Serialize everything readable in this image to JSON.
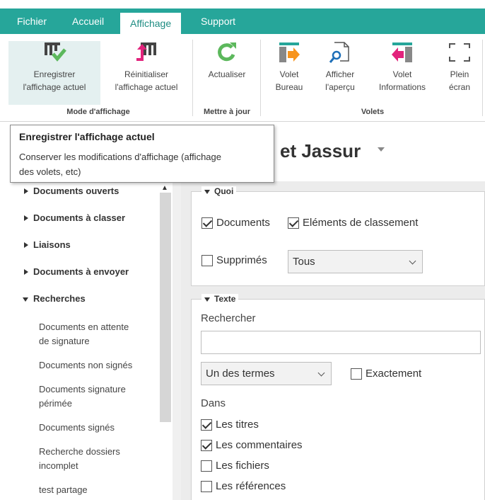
{
  "tabs": [
    "Fichier",
    "Accueil",
    "Affichage",
    "Support"
  ],
  "ribbon": {
    "enregistrer_l1": "Enregistrer",
    "enregistrer_l2": "l'affichage actuel",
    "reinitialiser_l1": "Réinitialiser",
    "reinitialiser_l2": "l'affichage actuel",
    "group_mode": "Mode d'affichage",
    "actualiser": "Actualiser",
    "group_maj": "Mettre à jour",
    "volet_bureau_l1": "Volet",
    "volet_bureau_l2": "Bureau",
    "apercu_l1": "Afficher",
    "apercu_l2": "l'aperçu",
    "volet_info_l1": "Volet",
    "volet_info_l2": "Informations",
    "plein_l1": "Plein",
    "plein_l2": "écran",
    "group_volets": "Volets"
  },
  "tooltip": {
    "title": "Enregistrer l'affichage actuel",
    "desc_l1": "Conserver les modifications d'affichage (affichage",
    "desc_l2": "des volets, etc)"
  },
  "page_title": "et Jassur",
  "sidebar": {
    "sections": [
      "Documents ouverts",
      "Documents à classer",
      "Liaisons",
      "Documents à envoyer",
      "Recherches"
    ],
    "items": [
      [
        "Documents en attente",
        "de signature"
      ],
      [
        "Documents non signés"
      ],
      [
        "Documents signature",
        "périmée"
      ],
      [
        "Documents signés"
      ],
      [
        "Recherche dossiers",
        "incomplet"
      ],
      [
        "test partage"
      ]
    ]
  },
  "quoi": {
    "legend": "Quoi",
    "documents": "Documents",
    "elements": "Eléments de classement",
    "supprimes": "Supprimés",
    "select_value": "Tous"
  },
  "texte": {
    "legend": "Texte",
    "rechercher": "Rechercher",
    "search_value": "",
    "mode_value": "Un des termes",
    "exactement": "Exactement",
    "dans": "Dans",
    "titres": "Les titres",
    "commentaires": "Les commentaires",
    "fichiers": "Les fichiers",
    "references": "Les références"
  },
  "colors": {
    "accent": "#26a69a",
    "check_green": "#5cb85c",
    "arrow_orange": "#f7941d",
    "arrow_pink": "#e2237c"
  }
}
